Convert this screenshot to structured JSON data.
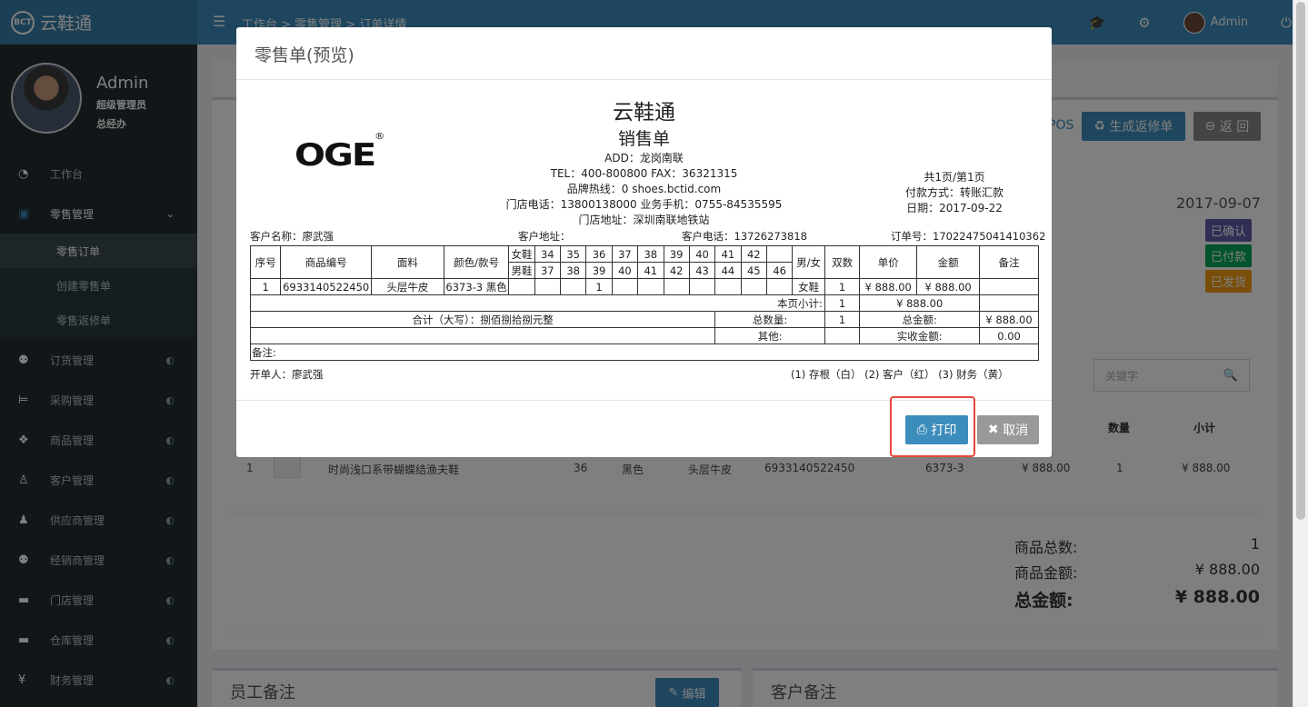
{
  "app": {
    "logo_badge": "BCT",
    "name": "云鞋通",
    "breadcrumb": "工作台 > 零售管理 > 订单详情",
    "admin_name": "Admin"
  },
  "user": {
    "name": "Admin",
    "role": "超级管理员",
    "dept": "总经办"
  },
  "menu": [
    {
      "icon": "dashboard-icon",
      "glyph": "◉",
      "label": "工作台"
    },
    {
      "icon": "money-icon",
      "glyph": "▣",
      "label": "零售管理",
      "open": true
    },
    {
      "icon": "users-icon",
      "glyph": "👥",
      "label": "订货管理"
    },
    {
      "icon": "cart-icon",
      "glyph": "🛒",
      "label": "采购管理"
    },
    {
      "icon": "cubes-icon",
      "glyph": "❖",
      "label": "商品管理"
    },
    {
      "icon": "male-icon",
      "glyph": "♂",
      "label": "客户管理"
    },
    {
      "icon": "user-icon",
      "glyph": "●",
      "label": "供应商管理"
    },
    {
      "icon": "group-icon",
      "glyph": "👥",
      "label": "经销商管理"
    },
    {
      "icon": "archive-icon",
      "glyph": "▬",
      "label": "门店管理"
    },
    {
      "icon": "warehouse-icon",
      "glyph": "▬",
      "label": "仓库管理"
    },
    {
      "icon": "yen-icon",
      "glyph": "¥",
      "label": "财务管理"
    }
  ],
  "submenu": [
    "零售订单",
    "创建零售单",
    "零售返修单"
  ],
  "page": {
    "pos_fragment": "POS",
    "btn_repair": "生成返修单",
    "btn_back": "返 回",
    "date": "2017-09-07",
    "status_confirmed": "已确认",
    "status_paid": "已付款",
    "status_shipped": "已发货",
    "search_placeholder": "关键字",
    "col_qty": "数量",
    "col_subtotal": "小计",
    "item": {
      "no": "1",
      "name": "时尚浅口系带蝴蝶结渔夫鞋",
      "size": "36",
      "color": "黑色",
      "material": "头层牛皮",
      "code": "6933140522450",
      "style": "6373-3",
      "price": "¥ 888.00",
      "qty": "1",
      "subtotal": "¥ 888.00"
    },
    "sum_qty_label": "商品总数:",
    "sum_qty": "1",
    "sum_amount_label": "商品金额:",
    "sum_amount": "¥ 888.00",
    "total_label": "总金额:",
    "total": "¥ 888.00",
    "staff_note": "员工备注",
    "btn_edit": "编辑",
    "customer_note": "客户备注"
  },
  "modal": {
    "title": "零售单(预览)",
    "logo": "OGE",
    "company": "云鞋通",
    "doc_title": "销售单",
    "add": "ADD：龙岗南联",
    "tel": "TEL：400-800800   FAX：36321315",
    "hotline": "品牌热线：0    shoes.bctid.com",
    "store_phone": "门店电话：13800138000    业务手机：0755-84535595",
    "store_addr": "门店地址：深圳南联地铁站",
    "page_info": "共1页/第1页",
    "payment": "付款方式：转账汇款",
    "date": "日期：2017-09-22",
    "customer_name": "客户名称：廖武强",
    "customer_addr": "客户地址：",
    "customer_phone": "客户电话：13726273818",
    "order_no": "订单号：17022475041410362",
    "h_seq": "序号",
    "h_code": "商品编号",
    "h_material": "面料",
    "h_color": "颜色/款号",
    "h_women": "女鞋",
    "h_men": "男鞋",
    "women_sizes": [
      "34",
      "35",
      "36",
      "37",
      "38",
      "39",
      "40",
      "41",
      "42",
      ""
    ],
    "men_sizes": [
      "37",
      "38",
      "39",
      "40",
      "41",
      "42",
      "43",
      "44",
      "45",
      "46"
    ],
    "h_gender": "男/女",
    "h_pairs": "双数",
    "h_price": "单价",
    "h_amount": "金额",
    "h_remark": "备注",
    "r_seq": "1",
    "r_code": "6933140522450",
    "r_material": "头层牛皮",
    "r_color": "6373-3 黑色",
    "r_sizes": [
      "",
      "",
      "1",
      "",
      "",
      "",
      "",
      "",
      "",
      ""
    ],
    "r_gender": "女鞋",
    "r_pairs": "1",
    "r_price": "¥ 888.00",
    "r_amount": "¥ 888.00",
    "page_subtotal_label": "本页小计:",
    "page_subtotal_pairs": "1",
    "page_subtotal_amount": "¥ 888.00",
    "total_words": "合计（大写）：捌佰捌拾捌元整",
    "total_qty_label": "总数量:",
    "total_qty": "1",
    "total_amount_label": "总金额:",
    "total_amount": "¥ 888.00",
    "other_label": "其他:",
    "received_label": "实收金额:",
    "received": "0.00",
    "remark_label": "备注:",
    "issuer": "开单人：廖武强",
    "copies": "(1) 存根（白） (2) 客户（红） (3) 财务（黄）",
    "btn_print": "打印",
    "btn_cancel": "取消"
  },
  "colors": {
    "header": "#3c8dbc",
    "logo_bg": "#367fa9",
    "sidebar": "#222d32",
    "primary": "#3c8dbc",
    "purple": "#605ca8",
    "green": "#00a65a",
    "yellow": "#f39c12",
    "highlight": "#e8463a"
  }
}
